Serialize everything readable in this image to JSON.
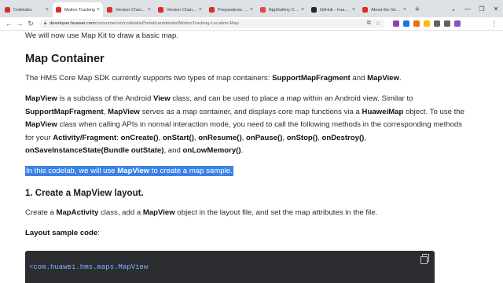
{
  "browser": {
    "tabs": [
      {
        "label": "Codelabs",
        "favicon_color": "#d93025",
        "active": false
      },
      {
        "label": "Motion Tracking",
        "favicon_color": "#d93025",
        "active": true
      },
      {
        "label": "Version Change",
        "favicon_color": "#d93025",
        "active": false
      },
      {
        "label": "Version Change",
        "favicon_color": "#d93025",
        "active": false
      },
      {
        "label": "Preparations for",
        "favicon_color": "#d93025",
        "active": false
      },
      {
        "label": "AppGallery Conn",
        "favicon_color": "#e8453c",
        "active": false
      },
      {
        "label": "GitHub - huawei",
        "favicon_color": "#24292f",
        "active": false
      },
      {
        "label": "About the Servic",
        "favicon_color": "#d93025",
        "active": false
      }
    ],
    "new_tab_glyph": "+",
    "window_controls": [
      "⌄",
      "—",
      "❐",
      "✕"
    ],
    "url_host": "developer.huawei.com",
    "url_path": "/consumer/en/codelabsPortal/carddetails/MotionTracking-Location-Map",
    "nav": {
      "back": "←",
      "forward": "→",
      "reload": "↻"
    },
    "omnibox_icons": [
      "⧉",
      "☆"
    ],
    "extension_colors": [
      "#8e44ad",
      "#1a73e8",
      "#e8710a",
      "#fbbc04",
      "#5f6368",
      "#5f6368",
      "#7e57c2"
    ],
    "menu_glyph": "⋮"
  },
  "page": {
    "intro": "We will now use Map Kit to draw a basic map.",
    "section_title": "Map Container",
    "para1": {
      "t1": "The HMS Core Map SDK currently supports two types of map containers: ",
      "b1": "SupportMapFragment",
      "t2": " and ",
      "b2": "MapView",
      "t3": "."
    },
    "para2": {
      "b1": "MapView",
      "t1": " is a subclass of the Android ",
      "b2": "View",
      "t2": " class, and can be used to place a map within an Android view. Similar to ",
      "b3": "SupportMapFragment",
      "t3": ", ",
      "b4": "MapView",
      "t4": " serves as a map container, and displays core map functions via a ",
      "b5": "HuaweiMap",
      "t5": " object. To use the ",
      "b6": "MapView",
      "t6": " class when calling APIs in normal interaction mode, you need to call the following methods in the corresponding methods for your ",
      "b7": "Activity/Fragment",
      "t7": ": ",
      "b8": "onCreate()",
      "t8": ", ",
      "b9": "onStart()",
      "t9": ", ",
      "b10": "onResume()",
      "t10": ", ",
      "b11": "onPause()",
      "t11": ", ",
      "b12": "onStop()",
      "t12": ", ",
      "b13": "onDestroy()",
      "t13": ", ",
      "b14": "onSaveInstanceState(Bundle outState)",
      "t14": ", and ",
      "b15": "onLowMemory()",
      "t15": "."
    },
    "highlight": {
      "t1": "In this codelab, we will use ",
      "b1": "MapView",
      "t2": " to create a map sample."
    },
    "step_title": "1. Create a MapView layout.",
    "step_para": {
      "t1": "Create a ",
      "b1": "MapActivity",
      "t2": " class, add a ",
      "b2": "MapView",
      "t3": " object in the layout file, and set the map attributes in the file."
    },
    "layout_label": "Layout sample code",
    "layout_label_suffix": ":",
    "code_line": "<com.huawei.hms.maps.MapView",
    "selection_color": "#3b82e6"
  }
}
